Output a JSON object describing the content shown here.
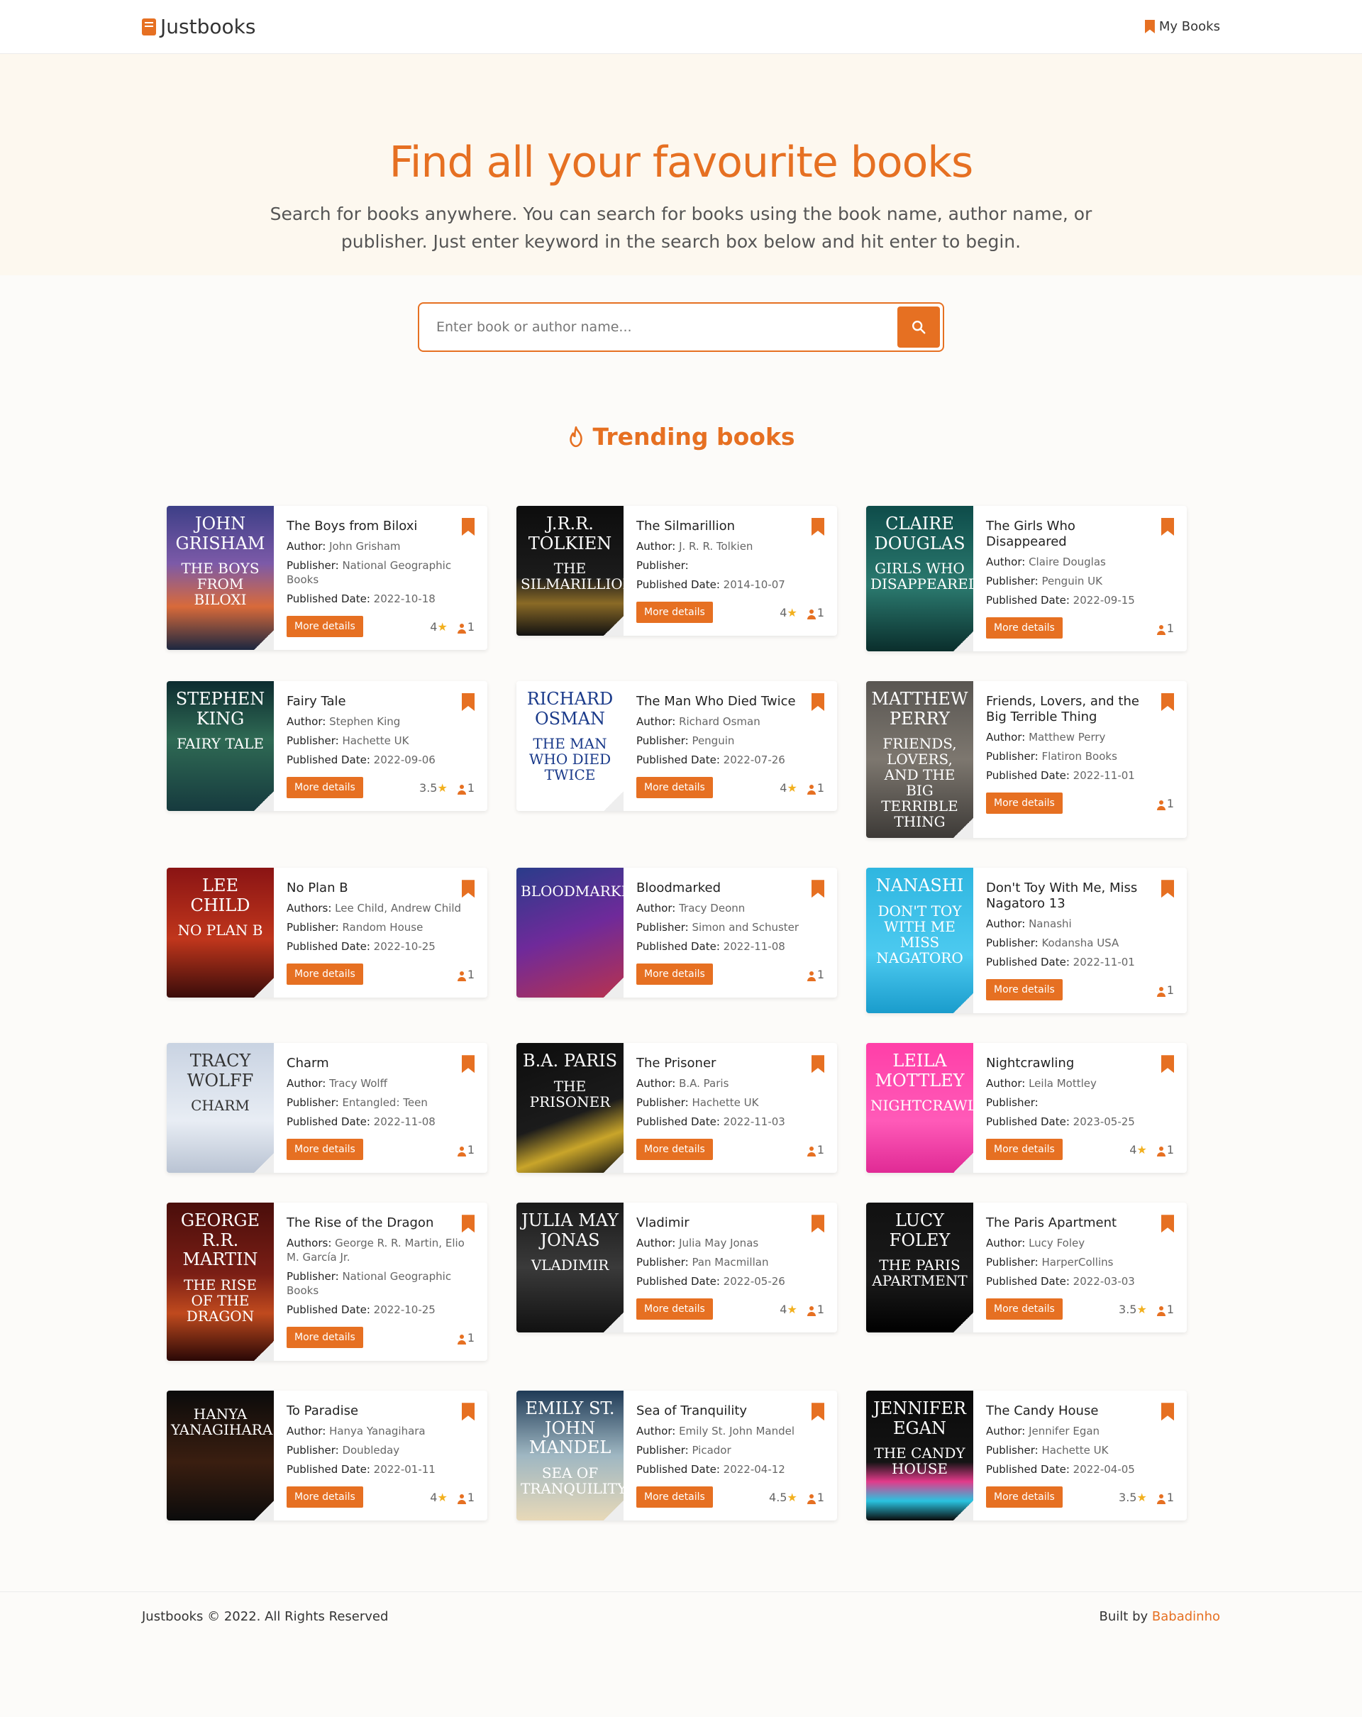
{
  "nav": {
    "brand": "Justbooks",
    "my_books": "My Books"
  },
  "hero": {
    "title": "Find all your favourite books",
    "subtitle": "Search for books anywhere. You can search for books using the book name, author name, or publisher. Just enter keyword in the search box below and hit enter to begin.",
    "search_placeholder": "Enter book or author name..."
  },
  "section_title": "Trending books",
  "labels": {
    "author": "Author:",
    "authors": "Authors:",
    "publisher": "Publisher:",
    "published": "Published Date:",
    "more": "More details"
  },
  "colors": {
    "accent": "#e67022",
    "hero_bg": "#fdf8ef",
    "star": "#f2b01e"
  },
  "books": [
    {
      "title": "The Boys from Biloxi",
      "author_label": "Author:",
      "author": "John Grisham",
      "publisher": "National Geographic Books",
      "date": "2022-10-18",
      "rating": "4",
      "users": "1",
      "cover_author": "John Grisham",
      "cover_title": "The Boys from Biloxi",
      "cover_bg": "linear-gradient(180deg,#3d3f87 0%,#7c5aa8 40%,#d86a3a 70%,#1c2740 100%)"
    },
    {
      "title": "The Silmarillion",
      "author_label": "Author:",
      "author": "J. R. R. Tolkien",
      "publisher": "",
      "date": "2014-10-07",
      "rating": "4",
      "users": "1",
      "cover_author": "J.R.R. Tolkien",
      "cover_title": "The Silmarillion",
      "cover_bg": "linear-gradient(180deg,#0d0d0d 0%,#1b1b1b 55%,#8a6a26 75%,#111 100%)"
    },
    {
      "title": "The Girls Who Disappeared",
      "author_label": "Author:",
      "author": "Claire Douglas",
      "publisher": "Penguin UK",
      "date": "2022-09-15",
      "rating": "",
      "users": "1",
      "cover_author": "Claire Douglas",
      "cover_title": "Girls Who Disappeared",
      "cover_bg": "linear-gradient(180deg,#0e4c4a 0%,#2b7a6f 55%,#0a2e2c 100%)"
    },
    {
      "title": "Fairy Tale",
      "author_label": "Author:",
      "author": "Stephen King",
      "publisher": "Hachette UK",
      "date": "2022-09-06",
      "rating": "3.5",
      "users": "1",
      "cover_author": "Stephen King",
      "cover_title": "Fairy Tale",
      "cover_bg": "linear-gradient(180deg,#0d2c30 0%,#2f6a54 45%,#163a3e 100%)"
    },
    {
      "title": "The Man Who Died Twice",
      "author_label": "Author:",
      "author": "Richard Osman",
      "publisher": "Penguin",
      "date": "2022-07-26",
      "rating": "4",
      "users": "1",
      "cover_author": "Richard Osman",
      "cover_title": "The Man Who Died Twice",
      "cover_bg": "linear-gradient(180deg,#ffffff 0%,#ffffff 100%)",
      "cover_color": "#1a3a8a"
    },
    {
      "title": "Friends, Lovers, and the Big Terrible Thing",
      "author_label": "Author:",
      "author": "Matthew Perry",
      "publisher": "Flatiron Books",
      "date": "2022-11-01",
      "rating": "",
      "users": "1",
      "cover_author": "Matthew Perry",
      "cover_title": "Friends, Lovers, and the Big Terrible Thing",
      "cover_bg": "linear-gradient(180deg,#595652 0%,#7d776f 50%,#3d3a37 100%)"
    },
    {
      "title": "No Plan B",
      "author_label": "Authors:",
      "author": "Lee Child, Andrew Child",
      "publisher": "Random House",
      "date": "2022-10-25",
      "rating": "",
      "users": "1",
      "cover_author": "Lee Child",
      "cover_title": "No Plan B",
      "cover_bg": "linear-gradient(180deg,#8a1414 0%,#c0361c 55%,#3a0c0a 100%)"
    },
    {
      "title": "Bloodmarked",
      "author_label": "Author:",
      "author": "Tracy Deonn",
      "publisher": "Simon and Schuster",
      "date": "2022-11-08",
      "rating": "",
      "users": "1",
      "cover_author": "",
      "cover_title": "Bloodmarked",
      "cover_bg": "linear-gradient(160deg,#2a3c8a 0%,#6f2a9a 50%,#b8324e 100%)"
    },
    {
      "title": "Don't Toy With Me, Miss Nagatoro 13",
      "author_label": "Author:",
      "author": "Nanashi",
      "publisher": "Kodansha USA",
      "date": "2022-11-01",
      "rating": "",
      "users": "1",
      "cover_author": "Nanashi",
      "cover_title": "Don't Toy With Me Miss Nagatoro",
      "cover_bg": "linear-gradient(180deg,#2fb6e0 0%,#4ccaf0 60%,#1a9ccc 100%)"
    },
    {
      "title": "Charm",
      "author_label": "Author:",
      "author": "Tracy Wolff",
      "publisher": "Entangled: Teen",
      "date": "2022-11-08",
      "rating": "",
      "users": "1",
      "cover_author": "Tracy Wolff",
      "cover_title": "Charm",
      "cover_bg": "linear-gradient(180deg,#c9d3e2 0%,#e8edf4 60%,#b9c3d3 100%)",
      "cover_color": "#333"
    },
    {
      "title": "The Prisoner",
      "author_label": "Author:",
      "author": "B.A. Paris",
      "publisher": "Hachette UK",
      "date": "2022-11-03",
      "rating": "",
      "users": "1",
      "cover_author": "B.A. Paris",
      "cover_title": "The Prisoner",
      "cover_bg": "linear-gradient(160deg,#0d0d0d 0%,#1b1b1b 55%,#c9a52a 75%,#111 100%)"
    },
    {
      "title": "Nightcrawling",
      "author_label": "Author:",
      "author": "Leila Mottley",
      "publisher": "",
      "date": "2023-05-25",
      "rating": "4",
      "users": "1",
      "cover_author": "Leila Mottley",
      "cover_title": "Nightcrawling",
      "cover_bg": "linear-gradient(180deg,#ff3fa8 0%,#ff5ab8 60%,#e02a95 100%)"
    },
    {
      "title": "The Rise of the Dragon",
      "author_label": "Authors:",
      "author": "George R. R. Martin, Elio M. García Jr.",
      "publisher": "National Geographic Books",
      "date": "2022-10-25",
      "rating": "",
      "users": "1",
      "cover_author": "George R.R. Martin",
      "cover_title": "The Rise of the Dragon",
      "cover_bg": "linear-gradient(180deg,#4a0e0b 0%,#7a1e15 45%,#c04a1e 70%,#2a0806 100%)"
    },
    {
      "title": "Vladimir",
      "author_label": "Author:",
      "author": "Julia May Jonas",
      "publisher": "Pan Macmillan",
      "date": "2022-05-26",
      "rating": "4",
      "users": "1",
      "cover_author": "Julia May Jonas",
      "cover_title": "Vladimir",
      "cover_bg": "linear-gradient(180deg,#1a1a1a 0%,#3a3a3a 50%,#111 100%)"
    },
    {
      "title": "The Paris Apartment",
      "author_label": "Author:",
      "author": "Lucy Foley",
      "publisher": "HarperCollins",
      "date": "2022-03-03",
      "rating": "3.5",
      "users": "1",
      "cover_author": "Lucy Foley",
      "cover_title": "The Paris Apartment",
      "cover_bg": "linear-gradient(180deg,#111 0%,#1a1a1a 60%,#000 100%)"
    },
    {
      "title": "To Paradise",
      "author_label": "Author:",
      "author": "Hanya Yanagihara",
      "publisher": "Doubleday",
      "date": "2022-01-11",
      "rating": "4",
      "users": "1",
      "cover_author": "",
      "cover_title": "Hanya Yanagihara",
      "cover_bg": "linear-gradient(180deg,#0b0b0b 0%,#3a1e10 55%,#0b0b0b 100%)"
    },
    {
      "title": "Sea of Tranquility",
      "author_label": "Author:",
      "author": "Emily St. John Mandel",
      "publisher": "Picador",
      "date": "2022-04-12",
      "rating": "4.5",
      "users": "1",
      "cover_author": "Emily St. John Mandel",
      "cover_title": "Sea of Tranquility",
      "cover_bg": "linear-gradient(180deg,#1f3a56 0%,#9fb7c2 50%,#e8d9b8 100%)"
    },
    {
      "title": "The Candy House",
      "author_label": "Author:",
      "author": "Jennifer Egan",
      "publisher": "Hachette UK",
      "date": "2022-04-05",
      "rating": "3.5",
      "users": "1",
      "cover_author": "Jennifer Egan",
      "cover_title": "The Candy House",
      "cover_bg": "linear-gradient(180deg,#0a0a0a 0%,#141414 55%,#e23a8a 70%,#2ac3e0 85%,#0a0a0a 100%)"
    }
  ],
  "footer": {
    "copyright": "Justbooks © 2022. All Rights Reserved",
    "built_by": "Built by",
    "author": "Babadinho"
  }
}
